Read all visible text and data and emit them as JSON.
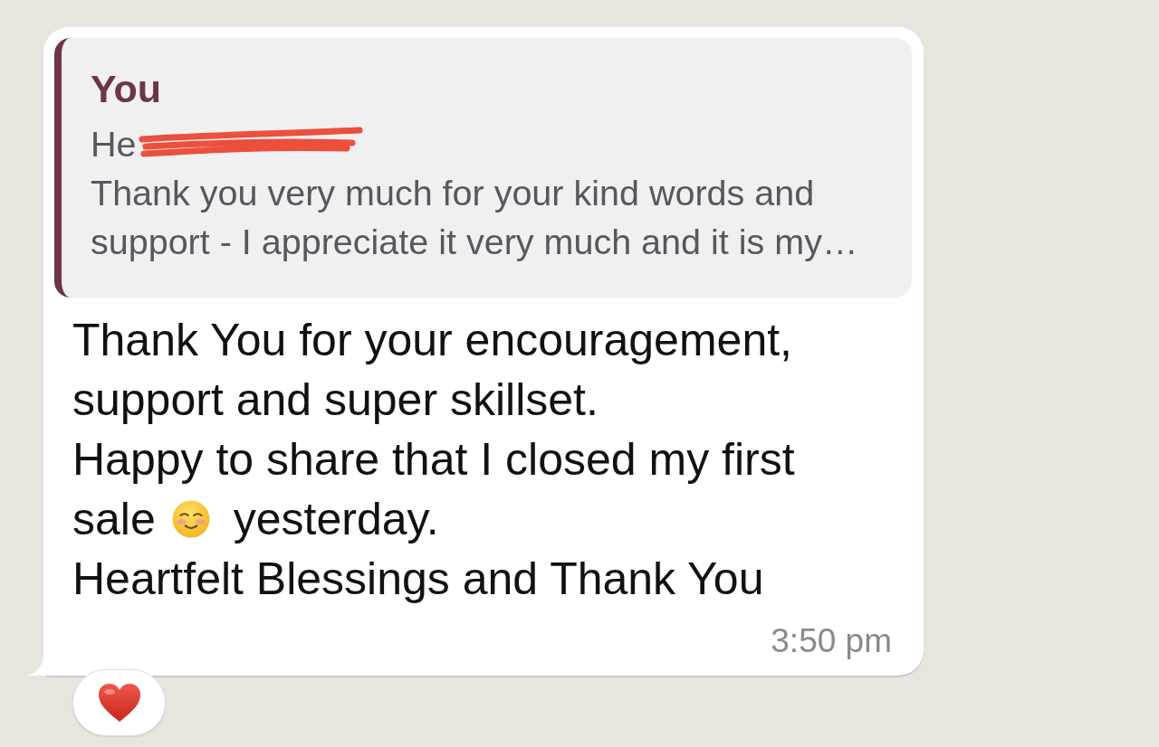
{
  "message": {
    "quote": {
      "sender": "You",
      "lines": [
        {
          "text": "He",
          "redacted": true
        },
        {
          "text": "Thank you very much for your kind words and",
          "redacted": false
        },
        {
          "text": "support - I appreciate it very much and it is my…",
          "redacted": false
        }
      ]
    },
    "lines": [
      {
        "segments": [
          {
            "kind": "text",
            "text": "Thank You for your encouragement,"
          }
        ]
      },
      {
        "segments": [
          {
            "kind": "text",
            "text": "support and super skillset."
          }
        ]
      },
      {
        "segments": [
          {
            "kind": "text",
            "text": "Happy to share that I closed my first"
          }
        ]
      },
      {
        "segments": [
          {
            "kind": "text",
            "text": "sale"
          },
          {
            "kind": "emoji"
          },
          {
            "kind": "text",
            "text": "yesterday."
          }
        ]
      },
      {
        "segments": [
          {
            "kind": "text",
            "text": "Heartfelt Blessings and Thank You"
          }
        ]
      }
    ],
    "time": "3:50 pm",
    "reactions": [
      {
        "kind": "heart"
      }
    ]
  }
}
